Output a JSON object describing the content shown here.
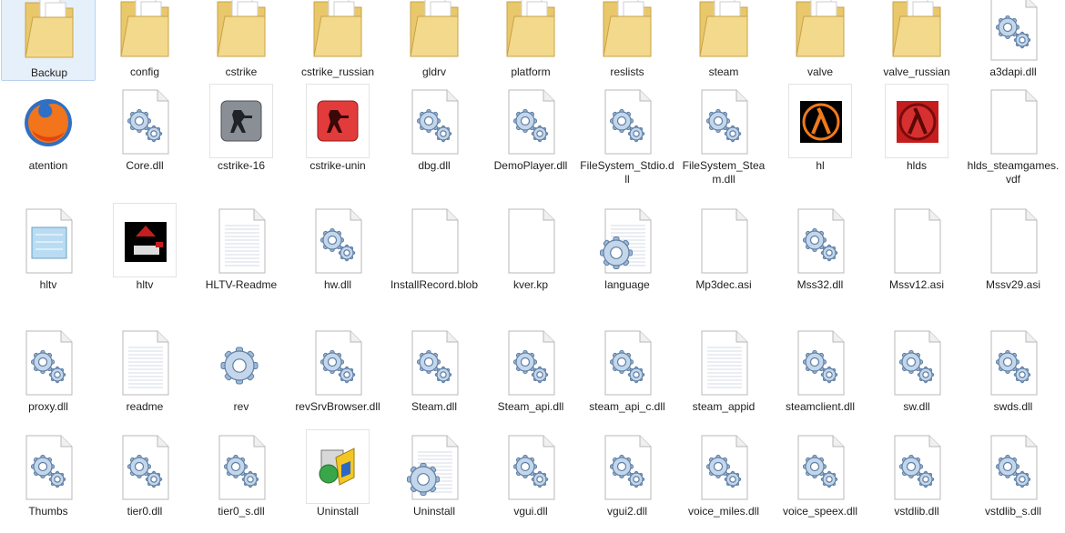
{
  "items": [
    {
      "label": "Backup",
      "icon": "folder-icon",
      "selected": true
    },
    {
      "label": "config",
      "icon": "folder-icon"
    },
    {
      "label": "cstrike",
      "icon": "folder-icon"
    },
    {
      "label": "cstrike_russian",
      "icon": "folder-icon"
    },
    {
      "label": "gldrv",
      "icon": "folder-icon"
    },
    {
      "label": "platform",
      "icon": "folder-icon"
    },
    {
      "label": "reslists",
      "icon": "folder-icon"
    },
    {
      "label": "steam",
      "icon": "folder-icon"
    },
    {
      "label": "valve",
      "icon": "folder-icon"
    },
    {
      "label": "valve_russian",
      "icon": "folder-icon"
    },
    {
      "label": "a3dapi.dll",
      "icon": "dll-gear-icon"
    },
    {
      "label": "atention",
      "icon": "firefox-icon"
    },
    {
      "label": "Core.dll",
      "icon": "dll-gear-icon"
    },
    {
      "label": "cstrike-16",
      "icon": "cstrike-gray-icon",
      "boxed": true
    },
    {
      "label": "cstrike-unin",
      "icon": "cstrike-red-icon",
      "boxed": true
    },
    {
      "label": "dbg.dll",
      "icon": "dll-gear-icon"
    },
    {
      "label": "DemoPlayer.dll",
      "icon": "dll-gear-icon"
    },
    {
      "label": "FileSystem_Stdio.dll",
      "icon": "dll-gear-icon"
    },
    {
      "label": "FileSystem_Steam.dll",
      "icon": "dll-gear-icon"
    },
    {
      "label": "hl",
      "icon": "half-life-orange-icon",
      "boxed": true
    },
    {
      "label": "hlds",
      "icon": "half-life-red-icon",
      "boxed": true
    },
    {
      "label": "hlds_steamgames.vdf",
      "icon": "blank-file-icon"
    },
    {
      "label": "hltv",
      "icon": "notepad-icon"
    },
    {
      "label": "hltv",
      "icon": "hltv-app-icon",
      "boxed": true
    },
    {
      "label": "HLTV-Readme",
      "icon": "text-file-icon"
    },
    {
      "label": "hw.dll",
      "icon": "dll-gear-icon"
    },
    {
      "label": "InstallRecord.blob",
      "icon": "blank-file-icon"
    },
    {
      "label": "kver.kp",
      "icon": "blank-file-icon"
    },
    {
      "label": "language",
      "icon": "config-file-icon"
    },
    {
      "label": "Mp3dec.asi",
      "icon": "blank-file-icon"
    },
    {
      "label": "Mss32.dll",
      "icon": "dll-gear-icon"
    },
    {
      "label": "Mssv12.asi",
      "icon": "blank-file-icon"
    },
    {
      "label": "Mssv29.asi",
      "icon": "blank-file-icon"
    },
    {
      "label": "proxy.dll",
      "icon": "dll-gear-icon"
    },
    {
      "label": "readme",
      "icon": "text-file-icon"
    },
    {
      "label": "rev",
      "icon": "gear-icon"
    },
    {
      "label": "revSrvBrowser.dll",
      "icon": "dll-gear-icon"
    },
    {
      "label": "Steam.dll",
      "icon": "dll-gear-icon"
    },
    {
      "label": "Steam_api.dll",
      "icon": "dll-gear-icon"
    },
    {
      "label": "steam_api_c.dll",
      "icon": "dll-gear-icon"
    },
    {
      "label": "steam_appid",
      "icon": "text-file-icon"
    },
    {
      "label": "steamclient.dll",
      "icon": "dll-gear-icon"
    },
    {
      "label": "sw.dll",
      "icon": "dll-gear-icon"
    },
    {
      "label": "swds.dll",
      "icon": "dll-gear-icon"
    },
    {
      "label": "Thumbs",
      "icon": "dll-gear-icon"
    },
    {
      "label": "tier0.dll",
      "icon": "dll-gear-icon"
    },
    {
      "label": "tier0_s.dll",
      "icon": "dll-gear-icon"
    },
    {
      "label": "Uninstall",
      "icon": "uninstaller-icon",
      "boxed": true
    },
    {
      "label": "Uninstall",
      "icon": "config-file-icon"
    },
    {
      "label": "vgui.dll",
      "icon": "dll-gear-icon"
    },
    {
      "label": "vgui2.dll",
      "icon": "dll-gear-icon"
    },
    {
      "label": "voice_miles.dll",
      "icon": "dll-gear-icon"
    },
    {
      "label": "voice_speex.dll",
      "icon": "dll-gear-icon"
    },
    {
      "label": "vstdlib.dll",
      "icon": "dll-gear-icon"
    },
    {
      "label": "vstdlib_s.dll",
      "icon": "dll-gear-icon"
    }
  ]
}
